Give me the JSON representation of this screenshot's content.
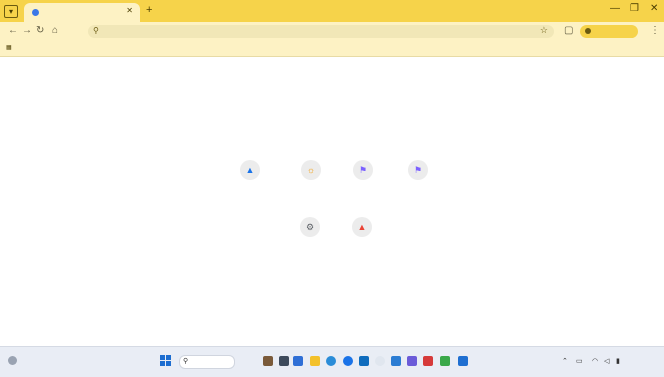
{
  "browser": {
    "tab": {
      "title": "",
      "close_icon": "close-icon"
    },
    "toolbar": {
      "address_text": "",
      "update_button": ""
    },
    "bookmarks": []
  },
  "new_tab": {
    "shortcuts": [
      {
        "label": "",
        "icon": "chevron-up-icon",
        "color": "#1a73e8"
      },
      {
        "label": "",
        "icon": "sun-icon",
        "color": "#f29900"
      },
      {
        "label": "",
        "icon": "flag-icon",
        "color": "#7b61ff"
      },
      {
        "label": "",
        "icon": "flag-icon",
        "color": "#7b61ff"
      },
      {
        "label": "",
        "icon": "gear-icon",
        "color": "#5f6368"
      },
      {
        "label": "",
        "icon": "chart-icon",
        "color": "#ea4335"
      }
    ]
  },
  "taskbar": {
    "weather": {
      "temp": "",
      "desc": ""
    },
    "search_placeholder": "",
    "clock": {
      "time": "",
      "date": ""
    }
  },
  "colors": {
    "tabstrip": "#f6d34a",
    "toolbar": "#fdf2c4",
    "taskbar": "#e9edf5"
  }
}
